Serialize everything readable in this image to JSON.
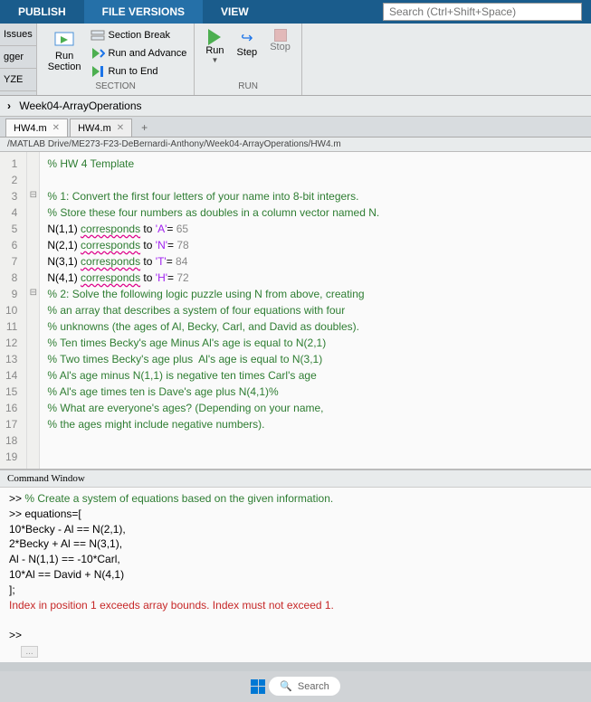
{
  "tabs": {
    "publish": "PUBLISH",
    "file_versions": "FILE VERSIONS",
    "view": "VIEW"
  },
  "search": {
    "placeholder": "Search (Ctrl+Shift+Space)"
  },
  "left_vertical_tabs": [
    "Issues",
    "gger",
    "YZE"
  ],
  "ribbon": {
    "section": {
      "run_section_btn": "Run\nSection",
      "section_break": "Section Break",
      "run_and_advance": "Run and Advance",
      "run_to_end": "Run to End",
      "label": "SECTION"
    },
    "run": {
      "run": "Run",
      "step": "Step",
      "stop": "Stop",
      "label": "RUN"
    }
  },
  "breadcrumb": "Week04-ArrayOperations",
  "file_tabs": [
    {
      "name": "HW4.m",
      "active": true
    },
    {
      "name": "HW4.m",
      "active": false
    }
  ],
  "plus": "+",
  "path": "/MATLAB Drive/ME273-F23-DeBernardi-Anthony/Week04-ArrayOperations/HW4.m",
  "code_lines": [
    {
      "n": "1",
      "html": "<span class='cm'>% HW 4 Template</span>"
    },
    {
      "n": "2",
      "html": ""
    },
    {
      "n": "3",
      "html": "<span class='cm'>% 1: Convert the first four letters of your name into 8-bit integers.</span>"
    },
    {
      "n": "4",
      "html": "<span class='cm'>% Store these four numbers as doubles in a column vector named N.</span>"
    },
    {
      "n": "5",
      "html": "N(1,1) <span class='err'>corresponds</span> to <span class='str'>'A'</span>= <span class='num'>65</span>"
    },
    {
      "n": "6",
      "html": "N(2,1) <span class='err'>corresponds</span> to <span class='str'>'N'</span>= <span class='num'>78</span>"
    },
    {
      "n": "7",
      "html": "N(3,1) <span class='err'>corresponds</span> to <span class='str'>'T'</span>= <span class='num'>84</span>"
    },
    {
      "n": "8",
      "html": "N(4,1) <span class='err'>corresponds</span> to <span class='str'>'H'</span>= <span class='num'>72</span>"
    },
    {
      "n": "9",
      "html": "<span class='cm'>% 2: Solve the following logic puzzle using N from above, creating</span>"
    },
    {
      "n": "10",
      "html": "<span class='cm'>% an array that describes a system of four equations with four</span>"
    },
    {
      "n": "11",
      "html": "<span class='cm'>% unknowns (the ages of Al, Becky, Carl, and David as doubles).</span>"
    },
    {
      "n": "12",
      "html": "<span class='cm'>% Ten times Becky's age Minus Al's age is equal to N(2,1)</span>"
    },
    {
      "n": "13",
      "html": "<span class='cm'>% Two times Becky's age plus  Al's age is equal to N(3,1)</span>"
    },
    {
      "n": "14",
      "html": "<span class='cm'>% Al's age minus N(1,1) is negative ten times Carl's age</span>"
    },
    {
      "n": "15",
      "html": "<span class='cm'>% Al's age times ten is Dave's age plus N(4,1)%</span>"
    },
    {
      "n": "16",
      "html": "<span class='cm'>% What are everyone's ages? (Depending on your name,</span>"
    },
    {
      "n": "17",
      "html": "<span class='cm'>% the ages might include negative numbers).</span>"
    },
    {
      "n": "18",
      "html": ""
    },
    {
      "n": "19",
      "html": ""
    }
  ],
  "fold_marks": {
    "3": "⊟",
    "9": "⊟"
  },
  "cmd": {
    "title": "Command Window",
    "lines": [
      {
        "html": ">> <span class='cm2'>% Create a system of equations based on the given information.</span>"
      },
      {
        "html": ">> equations=["
      },
      {
        "html": "10*Becky - Al == N(2,1),"
      },
      {
        "html": "2*Becky + Al == N(3,1),"
      },
      {
        "html": "Al - N(1,1) == -10*Carl,"
      },
      {
        "html": "10*Al == David + N(4,1)"
      },
      {
        "html": "];"
      },
      {
        "html": "<span class='errtxt'>Index in position 1 exceeds array bounds. Index must not exceed 1.</span>"
      },
      {
        "html": "&nbsp;"
      },
      {
        "html": ">>"
      },
      {
        "html": "&nbsp;&nbsp;&nbsp;&nbsp;<span class='fx'>...</span>"
      }
    ]
  },
  "taskbar_search": "Search"
}
